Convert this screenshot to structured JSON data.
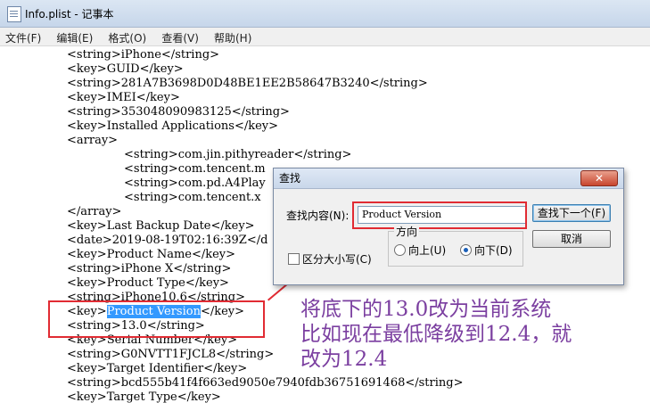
{
  "window": {
    "title": "Info.plist - 记事本"
  },
  "menu": [
    "文件(F)",
    "编辑(E)",
    "格式(O)",
    "查看(V)",
    "帮助(H)"
  ],
  "editor": {
    "lines": [
      "<string>iPhone</string>",
      "<key>GUID</key>",
      "<string>281A7B3698D0D48BE1EE2B58647B3240</string>",
      "<key>IMEI</key>",
      "<string>353048090983125</string>",
      "<key>Installed Applications</key>",
      "<array>",
      "<string>com.jin.pithyreader</string>",
      "<string>com.tencent.m",
      "<string>com.pd.A4Play",
      "<string>com.tencent.x",
      "</array>",
      "<key>Last Backup Date</key>",
      "<date>2019-08-19T02:16:39Z</d",
      "<key>Product Name</key>",
      "<string>iPhone X</string>",
      "<key>Product Type</key>",
      "<string>iPhone10,6</string>",
      "<key>",
      "Product Version",
      "</key>",
      "<string>13.0</string>",
      "<key>Serial Number</key>",
      "<string>G0NVTT1FJCL8</string>",
      "<key>Target Identifier</key>",
      "<string>bcd555b41f4f663ed9050e7940fdb36751691468</string>",
      "<key>Target Type</key>"
    ]
  },
  "dialog": {
    "title": "查找",
    "close": "✕",
    "find_label": "查找内容(N):",
    "find_value": "Product Version",
    "find_next": "查找下一个(F)",
    "cancel": "取消",
    "match_case": "区分大小写(C)",
    "direction_label": "方向",
    "up": "向上(U)",
    "down": "向下(D)"
  },
  "annotation": {
    "line1": "将底下的13.0改为当前系统",
    "line2": "比如现在最低降级到12.4，就",
    "line3": "改为12.4"
  },
  "colors": {
    "highlight": "#e12b33",
    "annotation": "#7b3fa0",
    "selection": "#3399ff"
  }
}
